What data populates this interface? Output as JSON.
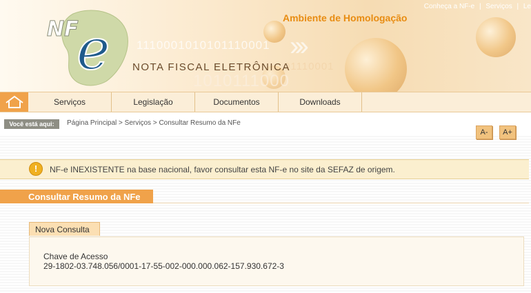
{
  "header": {
    "logo_text": "NF-e",
    "logo_subtitle": "NOTA FISCAL ELETRÔNICA",
    "environment": "Ambiente de Homologação",
    "top_links": [
      "Conheça a NF-e",
      "Serviços",
      "Le"
    ],
    "decor_binary": [
      "1110001010101110001",
      "01110001",
      "1010111000"
    ]
  },
  "nav": {
    "home_icon": "home-icon",
    "items": [
      {
        "label": "Serviços"
      },
      {
        "label": "Legislação"
      },
      {
        "label": "Documentos"
      },
      {
        "label": "Downloads"
      }
    ]
  },
  "breadcrumb": {
    "label": "Você está aqui:",
    "items": [
      "Página Principal",
      "Serviços",
      "Consultar Resumo da NFe"
    ],
    "separator": ">"
  },
  "font_controls": {
    "decrease": "A-",
    "increase": "A+"
  },
  "alert": {
    "icon": "exclamation-icon",
    "message": "NF-e INEXISTENTE na base nacional, favor consultar esta NF-e no site da SEFAZ de origem."
  },
  "section": {
    "title": "Consultar Resumo da NFe"
  },
  "tab": {
    "label": "Nova Consulta"
  },
  "form": {
    "chave_label": "Chave de Acesso",
    "chave_value": "29-1802-03.748.056/0001-17-55-002-000.000.062-157.930.672-3"
  },
  "colors": {
    "accent_orange": "#f0a24a",
    "environment_text": "#e88c12",
    "alert_bg": "#fbefcf"
  }
}
